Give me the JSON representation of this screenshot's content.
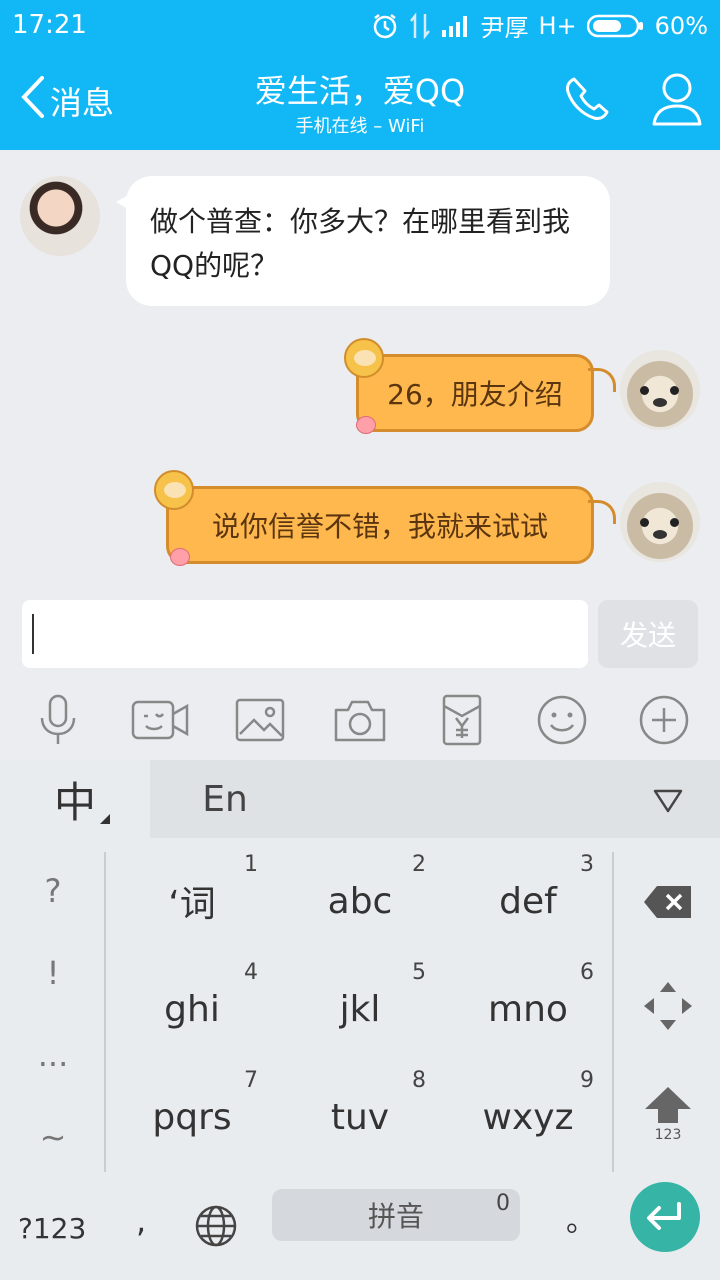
{
  "status_bar": {
    "time": "17:21",
    "carrier": "尹厚",
    "network": "H+",
    "battery": "60%"
  },
  "header": {
    "back_label": "消息",
    "title": "爱生活，爱QQ",
    "subtitle": "手机在线 – WiFi"
  },
  "messages": [
    {
      "side": "incoming",
      "text": "做个普查：你多大？在哪里看到我QQ的呢？"
    },
    {
      "side": "outgoing",
      "text": "26，朋友介绍"
    },
    {
      "side": "outgoing",
      "text": "说你信誉不错，我就来试试"
    }
  ],
  "composer": {
    "input_value": "",
    "send_label": "发送"
  },
  "toolbar": {
    "icons": [
      "microphone-icon",
      "video-call-icon",
      "image-icon",
      "camera-icon",
      "red-packet-icon",
      "emoji-icon",
      "plus-icon"
    ]
  },
  "keyboard": {
    "tab_cn": "中",
    "tab_en": "En",
    "side_keys": [
      "?",
      "!",
      "...",
      "~"
    ],
    "keys": [
      {
        "label": "‘词",
        "num": "1"
      },
      {
        "label": "abc",
        "num": "2"
      },
      {
        "label": "def",
        "num": "3"
      },
      {
        "label": "ghi",
        "num": "4"
      },
      {
        "label": "jkl",
        "num": "5"
      },
      {
        "label": "mno",
        "num": "6"
      },
      {
        "label": "pqrs",
        "num": "7"
      },
      {
        "label": "tuv",
        "num": "8"
      },
      {
        "label": "wxyz",
        "num": "9"
      }
    ],
    "shift_label": "123",
    "num_switch": "?123",
    "comma": ",",
    "space_label": "拼音",
    "space_num": "0",
    "period": "。"
  },
  "colors": {
    "header_bg": "#12b7f5",
    "bubble_out": "#ffb84d",
    "enter": "#36b5a7"
  }
}
